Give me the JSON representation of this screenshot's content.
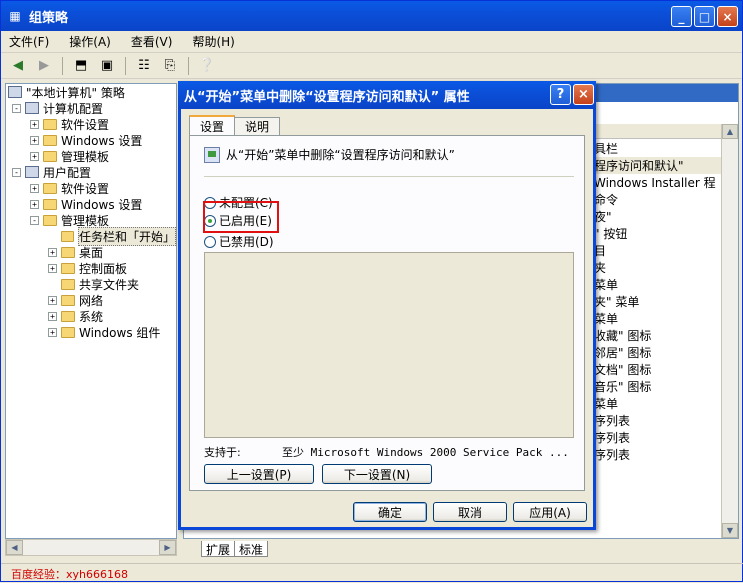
{
  "main": {
    "title": "组策略",
    "menu": [
      "文件(F)",
      "操作(A)",
      "查看(V)",
      "帮助(H)"
    ],
    "window_controls": [
      "_",
      "□",
      "×"
    ]
  },
  "tree": {
    "items": [
      {
        "label": "\"本地计算机\" 策略",
        "level": 0,
        "icon": "policy-icon"
      },
      {
        "label": "计算机配置",
        "level": 1,
        "icon": "computer-icon",
        "expander": "-"
      },
      {
        "label": "软件设置",
        "level": 2,
        "icon": "folder-icon",
        "expander": "+"
      },
      {
        "label": "Windows 设置",
        "level": 2,
        "icon": "folder-icon",
        "expander": "+"
      },
      {
        "label": "管理模板",
        "level": 2,
        "icon": "folder-icon",
        "expander": "+"
      },
      {
        "label": "用户配置",
        "level": 1,
        "icon": "user-icon",
        "expander": "-"
      },
      {
        "label": "软件设置",
        "level": 2,
        "icon": "folder-icon",
        "expander": "+"
      },
      {
        "label": "Windows 设置",
        "level": 2,
        "icon": "folder-icon",
        "expander": "+"
      },
      {
        "label": "管理模板",
        "level": 2,
        "icon": "folder-icon",
        "expander": "-"
      },
      {
        "label": "任务栏和「开始」",
        "level": 3,
        "icon": "folder-open-icon",
        "expander": "",
        "selected": true
      },
      {
        "label": "桌面",
        "level": 3,
        "icon": "folder-icon",
        "expander": "+"
      },
      {
        "label": "控制面板",
        "level": 3,
        "icon": "folder-icon",
        "expander": "+"
      },
      {
        "label": "共享文件夹",
        "level": 3,
        "icon": "folder-icon",
        "expander": ""
      },
      {
        "label": "网络",
        "level": 3,
        "icon": "folder-icon",
        "expander": "+"
      },
      {
        "label": "系统",
        "level": 3,
        "icon": "folder-icon",
        "expander": "+"
      },
      {
        "label": "Windows 组件",
        "level": 3,
        "icon": "folder-icon",
        "expander": "+"
      }
    ]
  },
  "right_list": {
    "rows": [
      "具栏",
      "程序访问和默认\"",
      "Windows Installer 程",
      "命令",
      "夜\"",
      "\" 按钮",
      "目",
      "夹",
      "菜单",
      "夹\" 菜单",
      "菜单",
      "收藏\" 图标",
      "邻居\" 图标",
      "文档\" 图标",
      "音乐\" 图标",
      "菜单",
      "序列表",
      "序列表",
      "序列表"
    ],
    "selected_index": 1
  },
  "bottom_tabs": [
    "扩展",
    "标准"
  ],
  "status": "百度经验：xyh666168",
  "dialog": {
    "title": "从“开始”菜单中删除“设置程序访问和默认”  属性",
    "help_btn": "?",
    "close_btn": "×",
    "tabs": [
      "设置",
      "说明"
    ],
    "policy_name": "从“开始”菜单中删除“设置程序访问和默认”",
    "radios": [
      {
        "label": "未配置(C)",
        "checked": false
      },
      {
        "label": "已启用(E)",
        "checked": true
      },
      {
        "label": "已禁用(D)",
        "checked": false
      }
    ],
    "support_label": "支持于:",
    "support_value": "至少 Microsoft Windows 2000 Service Pack ...",
    "prev_btn": "上一设置(P)",
    "next_btn": "下一设置(N)",
    "ok_btn": "确定",
    "cancel_btn": "取消",
    "apply_btn": "应用(A)"
  }
}
